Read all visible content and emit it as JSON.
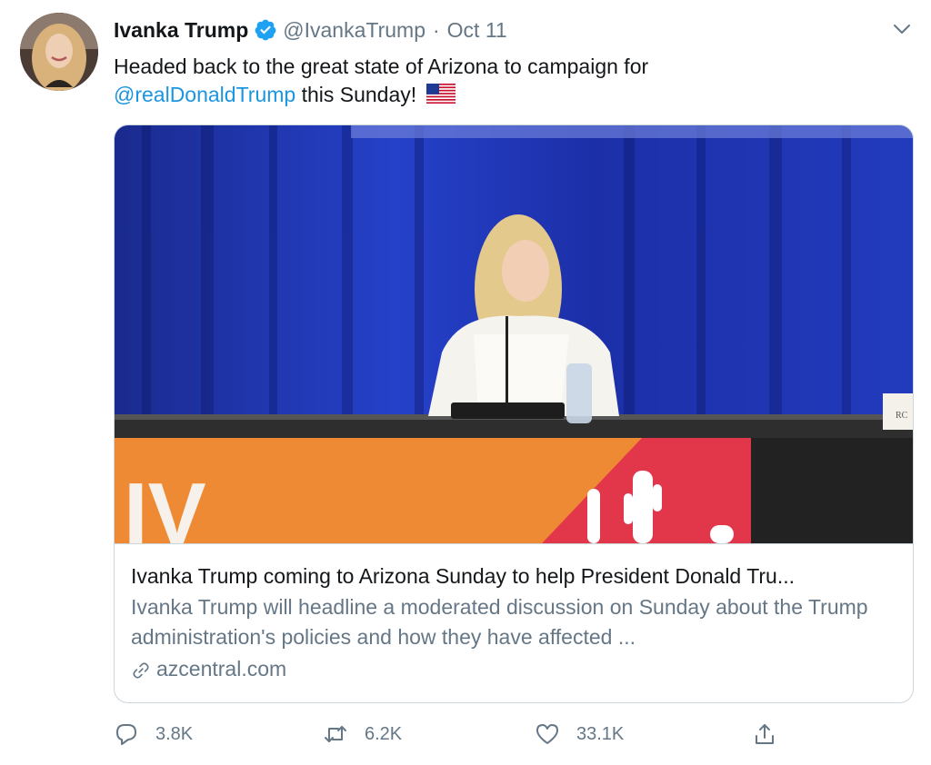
{
  "tweet": {
    "author_name": "Ivanka Trump",
    "handle": "@IvankaTrump",
    "separator": "·",
    "date": "Oct 11",
    "text_before": "Headed back to the great state of Arizona to campaign for",
    "mention": "@realDonaldTrump",
    "text_after": " this Sunday!",
    "flag_icon": "us-flag-emoji"
  },
  "card": {
    "title": "Ivanka Trump coming to Arizona Sunday to help President Donald Tru...",
    "description": "Ivanka Trump will headline a moderated discussion on Sunday about the Trump administration's policies and how they have affected ...",
    "domain": "azcentral.com",
    "image_banner_text": "IV",
    "image_placard_text": "RC"
  },
  "actions": {
    "reply_count": "3.8K",
    "retweet_count": "6.2K",
    "like_count": "33.1K"
  },
  "colors": {
    "link": "#1b95e0",
    "secondary_text": "#657786",
    "verified": "#1da1f2",
    "border": "#ccd6dd"
  }
}
